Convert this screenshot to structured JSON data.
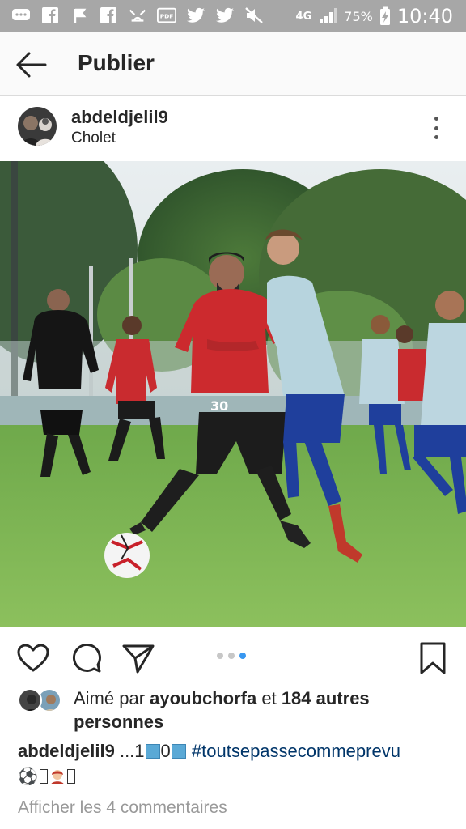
{
  "status_bar": {
    "network": "4G",
    "battery": "75%",
    "time": "10:40",
    "icons": [
      "chat-icon",
      "facebook-icon",
      "flag-icon",
      "facebook-icon",
      "cat-icon",
      "pdf-icon",
      "twitter-icon",
      "twitter-icon",
      "mute-icon"
    ]
  },
  "header": {
    "title": "Publier"
  },
  "post": {
    "username": "abdeldjelil9",
    "location": "Cholet",
    "carousel": {
      "count": 3,
      "active_index": 2
    }
  },
  "likes": {
    "prefix": "Aimé par",
    "first_liker": "ayoubchorfa",
    "connector": "et",
    "others": "184 autres personnes"
  },
  "caption": {
    "user": "abdeldjelil9",
    "text_before": "...1",
    "text_middle": "0",
    "hashtag": "#toutsepassecommeprevu",
    "emoji_ball": "⚽"
  },
  "comments_link": "Afficher les 4 commentaires",
  "colors": {
    "status_bar_bg": "#a7a7a7",
    "hashtag": "#003569",
    "carousel_active": "#3897f0"
  }
}
